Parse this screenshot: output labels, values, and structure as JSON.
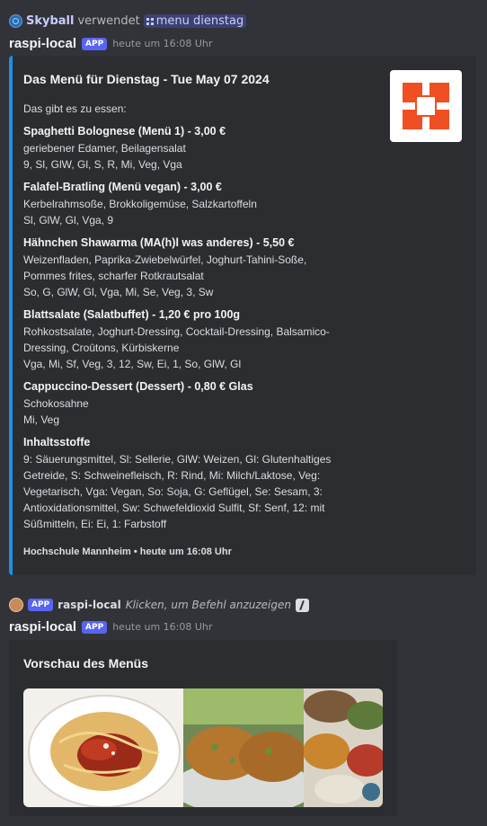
{
  "reply": {
    "user": "Skyball",
    "verb": "verwendet",
    "command": "menu dienstag"
  },
  "message1": {
    "author": "raspi-local",
    "badge": "APP",
    "timestamp": "heute um 16:08 Uhr",
    "embed": {
      "accent_color": "#1e90e8",
      "title": "Das Menü für Dienstag - Tue May 07 2024",
      "intro": "Das gibt es zu essen:",
      "fields": [
        {
          "name": "Spaghetti Bolognese (Menü 1) - 3,00 €",
          "lines": [
            "geriebener Edamer, Beilagensalat",
            "9, Sl, GlW, Gl, S, R, Mi, Veg, Vga"
          ]
        },
        {
          "name": "Falafel-Bratling (Menü vegan) - 3,00 €",
          "lines": [
            "Kerbelrahmsoße, Brokkoligemüse, Salzkartoffeln",
            "Sl, GlW, Gl, Vga, 9"
          ]
        },
        {
          "name": "Hähnchen Shawarma (MA(h)l was anderes) - 5,50 €",
          "lines": [
            "Weizenfladen, Paprika-Zwiebelwürfel, Joghurt-Tahini-Soße,",
            "Pommes frites, scharfer Rotkrautsalat",
            "So, G, GlW, Gl, Vga, Mi, Se, Veg, 3, Sw"
          ]
        },
        {
          "name": "Blattsalate (Salatbuffet) - 1,20 € pro 100g",
          "lines": [
            "Rohkostsalate, Joghurt-Dressing, Cocktail-Dressing, Balsamico-",
            "Dressing, Croûtons, Kürbiskerne",
            "Vga, Mi, Sf, Veg, 3, 12, Sw, Ei, 1, So, GlW, Gl"
          ]
        },
        {
          "name": "Cappuccino-Dessert (Dessert) - 0,80 € Glas",
          "lines": [
            "Schokosahne",
            "Mi, Veg"
          ]
        },
        {
          "name": "Inhaltsstoffe",
          "lines": [
            "9: Säuerungsmittel, Sl: Sellerie, GlW: Weizen, Gl: Glutenhaltiges",
            "Getreide, S: Schweinefleisch, R: Rind, Mi: Milch/Laktose, Veg:",
            "Vegetarisch, Vga: Vegan, So: Soja, G: Geflügel, Se: Sesam, 3:",
            "Antioxidationsmittel, Sw: Schwefeldioxid Sulfit, Sf: Senf, 12: mit",
            "Süßmitteln, Ei: Ei, 1: Farbstoff"
          ]
        }
      ],
      "footer": "Hochschule Mannheim • heute um 16:08 Uhr",
      "thumbnail_icon": "orange-logo-icon",
      "logo_color": "#f04e23"
    }
  },
  "command_row": {
    "badge": "APP",
    "author": "raspi-local",
    "text": "Klicken, um Befehl anzuzeigen"
  },
  "message2": {
    "author": "raspi-local",
    "badge": "APP",
    "timestamp": "heute um 16:08 Uhr",
    "embed": {
      "title": "Vorschau des Menüs",
      "images": [
        "spaghetti-photo",
        "falafel-photo",
        "shawarma-photo"
      ]
    }
  }
}
